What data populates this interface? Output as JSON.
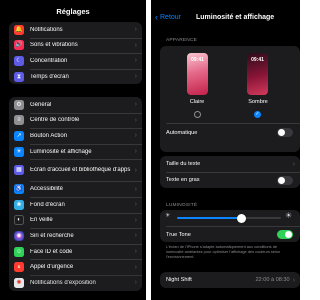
{
  "left": {
    "title": "Réglages",
    "group1": [
      {
        "label": "Notifications",
        "icon": "bell-icon",
        "color": "#ff3b30",
        "glyph": "🔔"
      },
      {
        "label": "Sons et vibrations",
        "icon": "speaker-icon",
        "color": "#ff2d55",
        "glyph": "🔊"
      },
      {
        "label": "Concentration",
        "icon": "moon-icon",
        "color": "#5e5ce6",
        "glyph": "☾"
      },
      {
        "label": "Temps d'écran",
        "icon": "hourglass-icon",
        "color": "#5e5ce6",
        "glyph": "⧗"
      }
    ],
    "group2": [
      {
        "label": "Général",
        "icon": "gear-icon",
        "color": "#8e8e93",
        "glyph": "⚙"
      },
      {
        "label": "Centre de contrôle",
        "icon": "switches-icon",
        "color": "#8e8e93",
        "glyph": "≡"
      },
      {
        "label": "Bouton Action",
        "icon": "action-button-icon",
        "color": "#0a84ff",
        "glyph": "↗"
      },
      {
        "label": "Luminosité et affichage",
        "icon": "brightness-icon",
        "color": "#0a84ff",
        "glyph": "☀"
      },
      {
        "label": "Écran d'accueil et bibliothèque d'apps",
        "icon": "home-screen-icon",
        "color": "#5e5ce6",
        "glyph": "▦"
      },
      {
        "label": "Accessibilité",
        "icon": "accessibility-icon",
        "color": "#0a84ff",
        "glyph": "♿"
      },
      {
        "label": "Fond d'écran",
        "icon": "wallpaper-icon",
        "color": "#32ade6",
        "glyph": "❀"
      },
      {
        "label": "En veille",
        "icon": "standby-icon",
        "color": "#1c1c1e",
        "glyph": "◐"
      },
      {
        "label": "Siri et recherche",
        "icon": "siri-icon",
        "color": "#2c2c2e",
        "glyph": "◉"
      },
      {
        "label": "Face ID et code",
        "icon": "face-id-icon",
        "color": "#30d158",
        "glyph": "☺"
      },
      {
        "label": "Appel d'urgence",
        "icon": "sos-icon",
        "color": "#ff3b30",
        "glyph": "S"
      },
      {
        "label": "Notifications d'exposition",
        "icon": "exposure-icon",
        "color": "#ffffff",
        "glyph": "✺"
      }
    ]
  },
  "right": {
    "back_label": "Retour",
    "title": "Luminosité et affichage",
    "appearance": {
      "header": "APPARENCE",
      "light": {
        "time": "09:41",
        "label": "Claire",
        "selected": false
      },
      "dark": {
        "time": "09:41",
        "label": "Sombre",
        "selected": true
      },
      "auto_label": "Automatique",
      "auto_on": false
    },
    "text_group": {
      "text_size_label": "Taille du texte",
      "bold_label": "Texte en gras",
      "bold_on": false
    },
    "brightness": {
      "header": "LUMINOSITÉ",
      "level": 0.62,
      "true_tone_label": "True Tone",
      "true_tone_on": true,
      "footnote": "L'écran de l'iPhone s'adapte automatiquement aux conditions de luminosité ambiantes pour optimiser l'affichage des couleurs selon l'environnement."
    },
    "night_shift": {
      "label": "Night Shift",
      "value": "22:00 à 08:30"
    }
  },
  "colors": {
    "background": "#000000",
    "cell": "#1c1c1e",
    "accent": "#0a84ff",
    "toggle_on": "#30d158",
    "secondary_text": "#8e8e93"
  }
}
